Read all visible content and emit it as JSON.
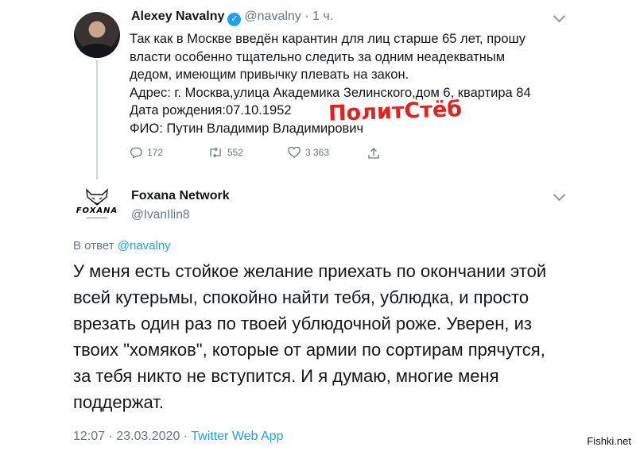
{
  "tweet1": {
    "name": "Alexey Navalny",
    "handle": "@navalny",
    "separator": "·",
    "time": "1 ч.",
    "lines": [
      "Так как в Москве введён карантин для лиц старше 65 лет, прошу",
      "власти особенно тщательно следить за одним неадекватным",
      "дедом, имеющим привычку плевать на закон.",
      "Адрес: г. Москва,улица Академика Зелинского,дом 6, квартира 84",
      "Дата рождения:07.10.1952",
      "ФИО: Путин Владимир Владимирович"
    ],
    "stats": {
      "replies": "172",
      "retweets": "552",
      "likes": "3 363"
    }
  },
  "stamp": "ПолитСтёб",
  "tweet2": {
    "name": "Foxana Network",
    "handle": "@IvanIlin8",
    "avatar_logo_text": "FOXANA",
    "reply_prefix": "В ответ",
    "reply_mention": "@navalny",
    "lines": [
      "У меня есть стойкое желание приехать по окончании этой",
      "всей кутерьмы, спокойно найти тебя, ублюдка, и просто",
      "врезать один раз по твоей ублюдочной роже. Уверен, из",
      "твоих \"хомяков\", которые от армии по сортирам прячутся,",
      "за тебя никто не вступится. И я думаю, многие меня",
      "поддержат."
    ],
    "timestamp": "12:07 · 23.03.2020 · ",
    "source": "Twitter Web App"
  },
  "site_watermark": "Fishki.net",
  "colors": {
    "link": "#1da1f2",
    "secondary": "#657786",
    "stamp": "#e0231f"
  }
}
